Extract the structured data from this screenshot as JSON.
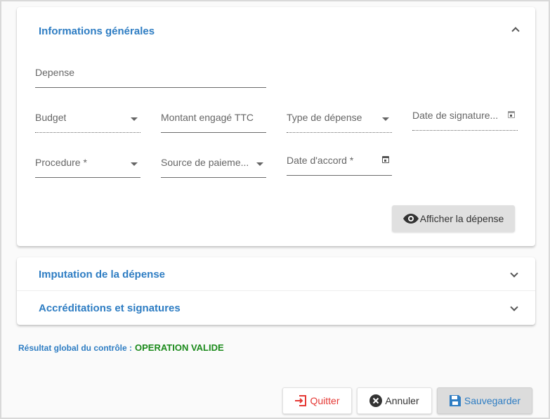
{
  "sections": {
    "general": {
      "title": "Informations générales"
    },
    "imputation": {
      "title": "Imputation de la dépense"
    },
    "accreditations": {
      "title": "Accréditations et signatures"
    }
  },
  "fields": {
    "depense": "Depense",
    "budget": "Budget",
    "montant": "Montant engagé TTC",
    "type_depense": "Type de dépense",
    "date_signature": "Date de signature...",
    "procedure": "Procedure *",
    "source_paiement": "Source de paieme...",
    "date_accord": "Date d'accord *"
  },
  "buttons": {
    "afficher": "Afficher la dépense",
    "quitter": "Quitter",
    "annuler": "Annuler",
    "sauvegarder": "Sauvegarder"
  },
  "result": {
    "label": "Résultat global du contrôle :",
    "status": "OPERATION VALIDE"
  },
  "colors": {
    "accent": "#2e7dc3",
    "success": "#1b8a1b",
    "danger": "#e53935"
  },
  "icons": {
    "collapse": "chevron-up-icon",
    "expand": "chevron-down-icon",
    "select": "dropdown-arrow-icon",
    "date": "calendar-icon",
    "show": "eye-icon",
    "quit": "exit-icon",
    "cancel": "close-circle-icon",
    "save": "floppy-disk-icon"
  }
}
